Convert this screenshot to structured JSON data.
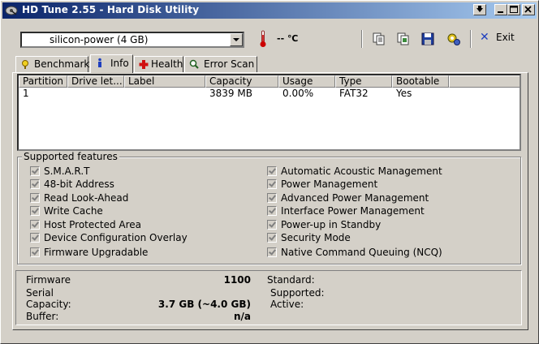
{
  "window": {
    "title": "HD Tune 2.55 - Hard Disk Utility",
    "icon": "hdtune-app-icon",
    "buttons": {
      "help": "?",
      "minimize": "_",
      "maximize": "□",
      "close": "✕"
    }
  },
  "toolbar": {
    "drive_select": "silicon-power (4 GB)",
    "temperature": "-- ℃",
    "icons": [
      "copy-text-icon",
      "copy-screenshot-icon",
      "save-icon",
      "options-icon"
    ],
    "exit_label": "Exit"
  },
  "tabs": [
    {
      "label": "Benchmark",
      "icon": "benchmark-icon"
    },
    {
      "label": "Info",
      "icon": "info-icon",
      "active": true
    },
    {
      "label": "Health",
      "icon": "health-icon"
    },
    {
      "label": "Error Scan",
      "icon": "error-scan-icon"
    }
  ],
  "partition_table": {
    "columns": [
      "Partition",
      "Drive let...",
      "Label",
      "Capacity",
      "Usage",
      "Type",
      "Bootable"
    ],
    "rows": [
      [
        "1",
        "",
        "",
        "3839 MB",
        "0.00%",
        "FAT32",
        "Yes"
      ]
    ]
  },
  "features": {
    "title": "Supported features",
    "left": [
      {
        "label": "S.M.A.R.T",
        "checked": true
      },
      {
        "label": "48-bit Address",
        "checked": true
      },
      {
        "label": "Read Look-Ahead",
        "checked": true
      },
      {
        "label": "Write Cache",
        "checked": true
      },
      {
        "label": "Host Protected Area",
        "checked": true
      },
      {
        "label": "Device Configuration Overlay",
        "checked": true
      },
      {
        "label": "Firmware Upgradable",
        "checked": true
      }
    ],
    "right": [
      {
        "label": "Automatic Acoustic Management",
        "checked": true
      },
      {
        "label": "Power Management",
        "checked": true
      },
      {
        "label": "Advanced Power Management",
        "checked": true
      },
      {
        "label": "Interface Power Management",
        "checked": true
      },
      {
        "label": "Power-up in Standby",
        "checked": true
      },
      {
        "label": "Security Mode",
        "checked": true
      },
      {
        "label": "Native Command Queuing (NCQ)",
        "checked": true
      }
    ]
  },
  "info": {
    "firmware_label": "Firmware",
    "firmware_value": "1100",
    "serial_label": "Serial",
    "serial_value": "",
    "capacity_label": "Capacity:",
    "capacity_value": "3.7 GB (~4.0 GB)",
    "buffer_label": "Buffer:",
    "buffer_value": "n/a",
    "standard_label": "Standard:",
    "supported_label": "Supported:",
    "active_label": "Active:"
  },
  "colors": {
    "titlebar_start": "#0a246a",
    "titlebar_end": "#a6caf0",
    "face": "#d4d0c8",
    "thermometer": "#cc0000",
    "exit_x": "#1f3fbf"
  }
}
